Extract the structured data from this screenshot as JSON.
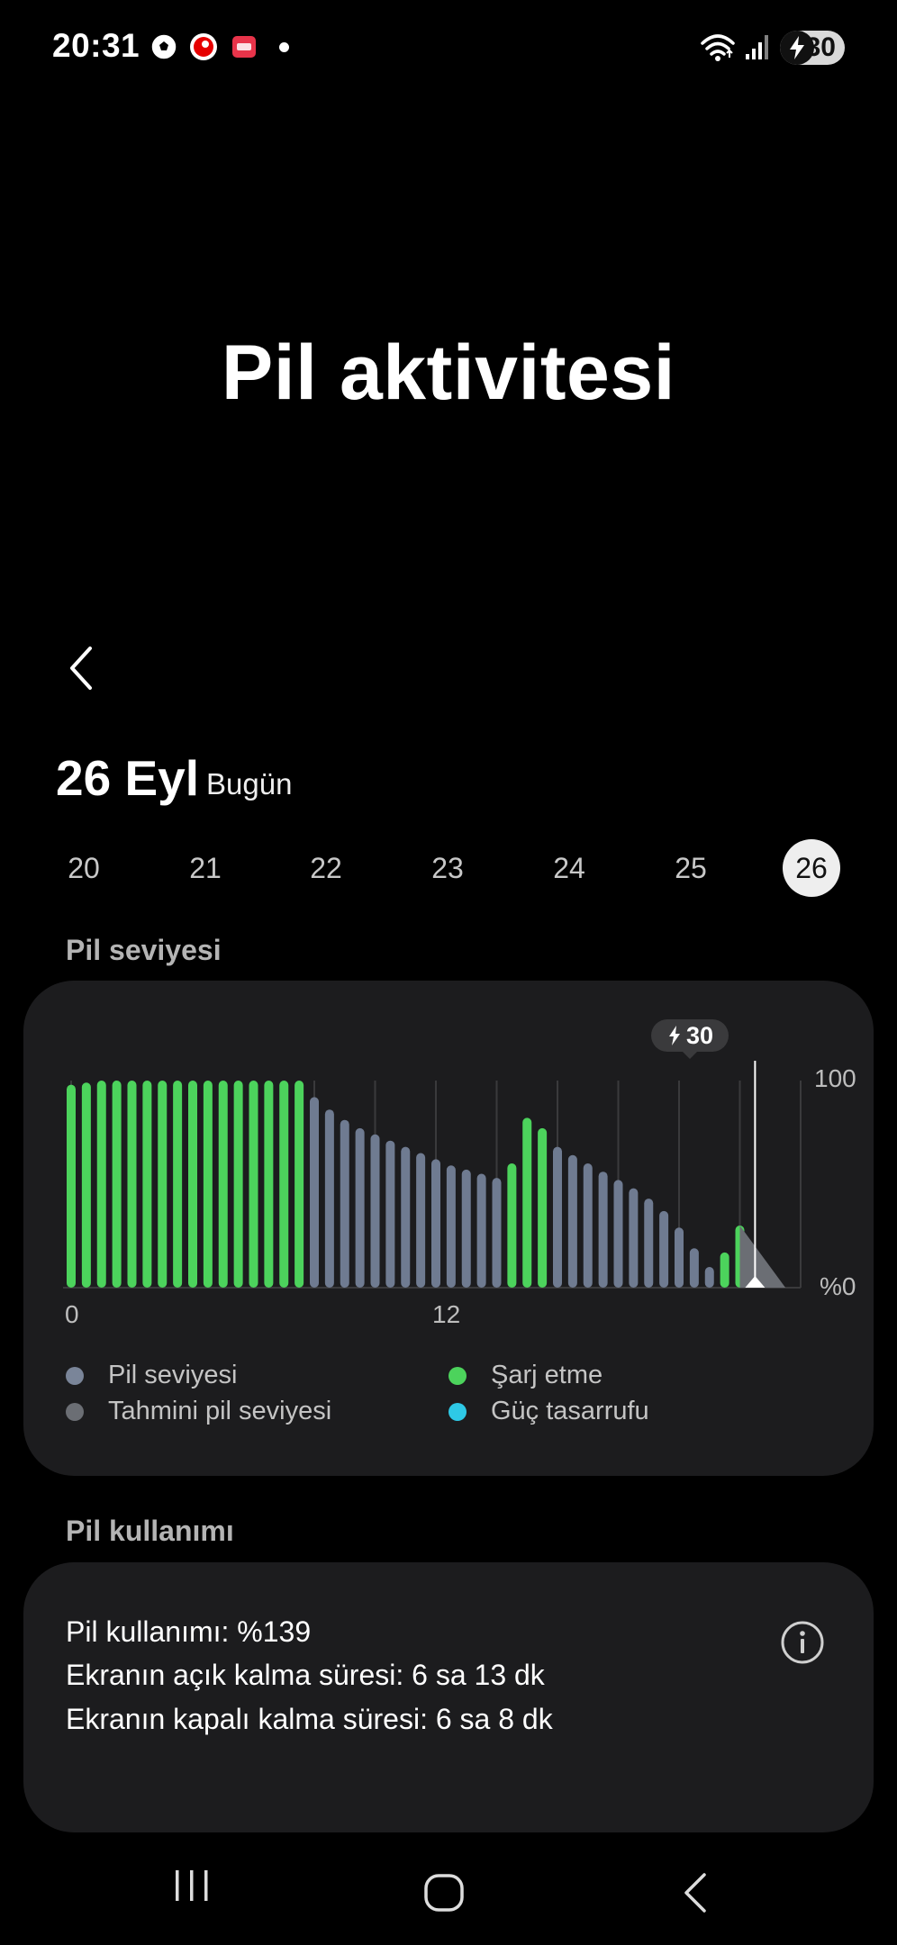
{
  "status_bar": {
    "time": "20:31",
    "battery_level": "30",
    "icons": [
      "football-icon",
      "vodafone-icon",
      "app-notification-icon",
      "wifi-icon",
      "signal-icon",
      "battery-charging-icon"
    ]
  },
  "page_title": "Pil aktivitesi",
  "date_header": {
    "date": "26 Eyl",
    "label": "Bugün"
  },
  "day_selector": {
    "days": [
      "20",
      "21",
      "22",
      "23",
      "24",
      "25",
      "26"
    ],
    "selected": "26"
  },
  "battery_level_section": {
    "title": "Pil seviyesi",
    "tooltip_value": "30",
    "legend": {
      "battery_level": "Pil seviyesi",
      "charging": "Şarj etme",
      "estimated": "Tahmini pil seviyesi",
      "power_saving": "Güç tasarrufu"
    }
  },
  "colors": {
    "charging": "#4cd35c",
    "battery": "#6f7b91",
    "estimated": "#6b6e74",
    "power_saving": "#2ec9e6",
    "card_bg": "#1c1c1e"
  },
  "chart_data": {
    "type": "bar",
    "y_unit_top": "100",
    "y_unit_bottom": "%0",
    "ylim": [
      0,
      100
    ],
    "x_tick_labels": [
      {
        "label": "0",
        "hour": 0
      },
      {
        "label": "12",
        "hour": 12
      }
    ],
    "x_range_hours": [
      0,
      24
    ],
    "series": [
      {
        "name": "Pil seviyesi",
        "hours": [
          8,
          8.5,
          9,
          9.5,
          10,
          10.5,
          11,
          11.5,
          12,
          12.5,
          13,
          13.5,
          14,
          16,
          16.5,
          17,
          17.5,
          18,
          18.5,
          19,
          19.5,
          20,
          20.5,
          21
        ],
        "values": [
          92,
          86,
          81,
          77,
          74,
          71,
          68,
          65,
          62,
          59,
          57,
          55,
          53,
          68,
          64,
          60,
          56,
          52,
          48,
          43,
          37,
          29,
          19,
          10
        ]
      },
      {
        "name": "Şarj etme",
        "hours": [
          0,
          0.5,
          1,
          1.5,
          2,
          2.5,
          3,
          3.5,
          4,
          4.5,
          5,
          5.5,
          6,
          6.5,
          7,
          7.5,
          14.5,
          15,
          15.5,
          21.5,
          22
        ],
        "values": [
          98,
          99,
          100,
          100,
          100,
          100,
          100,
          100,
          100,
          100,
          100,
          100,
          100,
          100,
          100,
          100,
          60,
          82,
          77,
          17,
          30
        ]
      },
      {
        "name": "Tahmini pil seviyesi",
        "hours": [
          22,
          23.5
        ],
        "values": [
          30,
          0
        ]
      }
    ],
    "current_hour": 22.5
  },
  "battery_usage_section": {
    "title": "Pil kullanımı",
    "usage": "Pil kullanımı: %139",
    "screen_on": "Ekranın açık kalma süresi: 6 sa 13 dk",
    "screen_off": "Ekranın kapalı kalma süresi: 6 sa 8 dk"
  },
  "nav_bar": {
    "recents": "recents-icon",
    "home": "home-icon",
    "back": "back-icon"
  }
}
